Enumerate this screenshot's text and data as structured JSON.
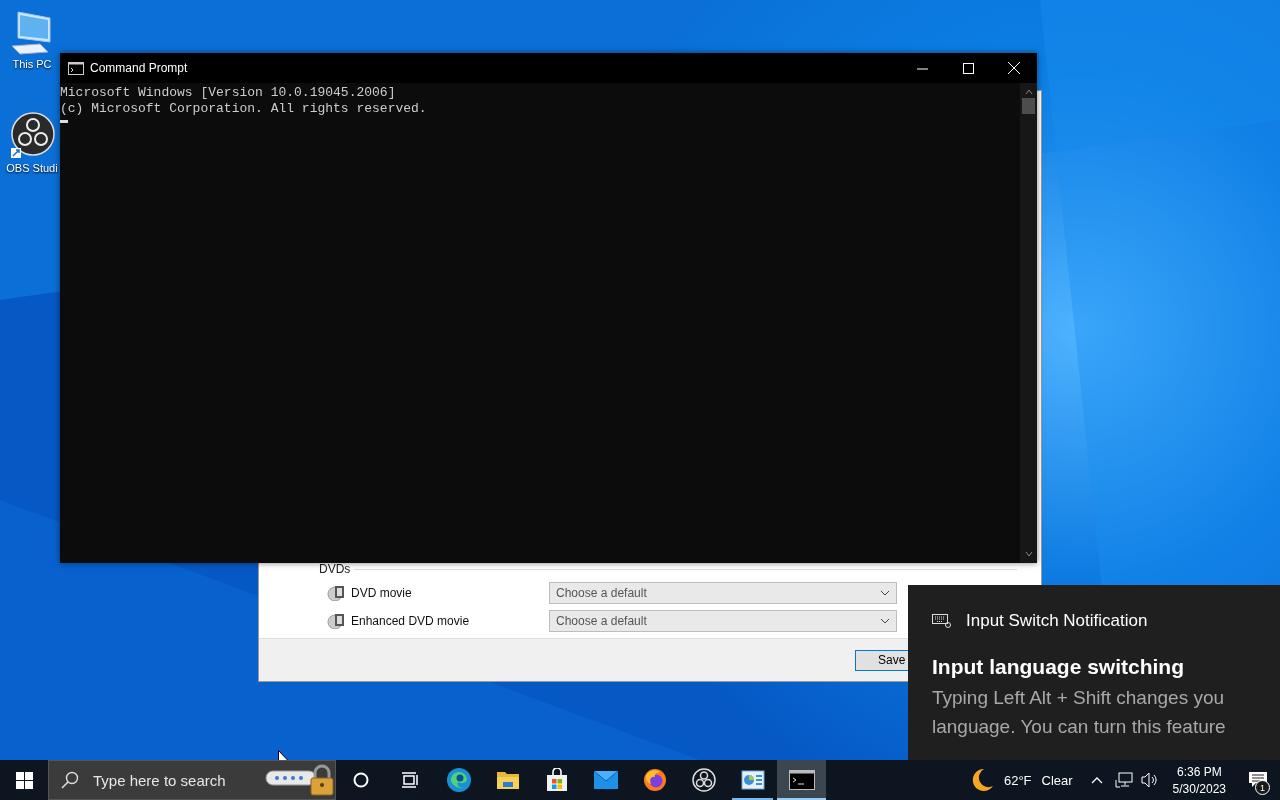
{
  "desktop_icons": [
    {
      "kind": "computer",
      "label": "This PC"
    },
    {
      "kind": "obs",
      "label": "OBS Studi"
    }
  ],
  "settings_dialog": {
    "group": "DVDs",
    "rows": [
      {
        "label": "DVD movie",
        "placeholder": "Choose a default"
      },
      {
        "label": "Enhanced DVD movie",
        "placeholder": "Choose a default"
      }
    ],
    "save": "Save"
  },
  "console_window": {
    "title": "Command Prompt",
    "lines": [
      "Microsoft Windows [Version 10.0.19045.2006]",
      "(c) Microsoft Corporation. All rights reserved."
    ]
  },
  "notification": {
    "app": "Input Switch Notification",
    "heading": "Input language switching",
    "body": [
      "Typing Left Alt + Shift changes you",
      "language. You can turn this feature"
    ]
  },
  "taskbar": {
    "search": {
      "placeholder": "Type here to search"
    },
    "apps": [
      {
        "kind": "cortana",
        "running": false,
        "selected": false
      },
      {
        "kind": "taskview",
        "running": false,
        "selected": false
      },
      {
        "kind": "edge",
        "running": false,
        "selected": false
      },
      {
        "kind": "explorer",
        "running": false,
        "selected": false
      },
      {
        "kind": "store",
        "running": false,
        "selected": false
      },
      {
        "kind": "mail",
        "running": false,
        "selected": false
      },
      {
        "kind": "firefox",
        "running": false,
        "selected": false
      },
      {
        "kind": "obs",
        "running": false,
        "selected": false
      },
      {
        "kind": "controlpanel",
        "running": true,
        "selected": false
      },
      {
        "kind": "console",
        "running": true,
        "selected": true
      }
    ],
    "weather": {
      "temperature": "62°F",
      "condition": "Clear"
    },
    "time": "6:36 PM",
    "date": "5/30/2023",
    "notification_count": "1"
  }
}
